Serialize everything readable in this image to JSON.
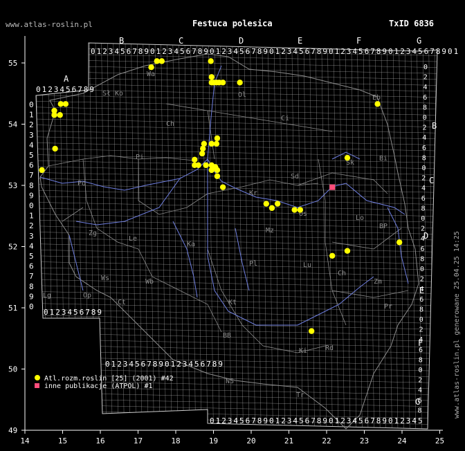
{
  "header": {
    "site": "www.atlas-roslin.pl",
    "title": "Festuca polesica",
    "taxon_id": "TxID 6836"
  },
  "side_note": "www.atlas-roslin.pl generowane 25.04.25 14:25",
  "legend": {
    "items": [
      {
        "label": "Atl.rozm.roslin [25] (2001) #42",
        "color": "#ffff00",
        "marker": "circle"
      },
      {
        "label": "inne publikacje (ATPOL) #1",
        "color": "#ff4d7a",
        "marker": "square"
      }
    ]
  },
  "colors": {
    "background": "#000000",
    "grid": "#b8b8b8",
    "rivers": "#6f7fe0",
    "regions": "#8c8c8c",
    "text": "#ffffff",
    "point_primary": "#ffff00",
    "point_secondary": "#ff4d7a"
  },
  "chart_data": {
    "type": "scatter",
    "x_axis": {
      "ticks": [
        "14",
        "15",
        "16",
        "17",
        "18",
        "19",
        "20",
        "21",
        "22",
        "23",
        "24",
        "25"
      ],
      "range": [
        14,
        25
      ]
    },
    "y_axis": {
      "ticks": [
        "49",
        "50",
        "51",
        "52",
        "53",
        "54",
        "55"
      ],
      "range": [
        49,
        55.4
      ]
    },
    "atpol_columns": [
      "A",
      "B",
      "C",
      "D",
      "E",
      "F",
      "G"
    ],
    "atpol_rows": [
      "A",
      "B",
      "C",
      "D",
      "E",
      "F",
      "G"
    ],
    "digit_string": "0123456789",
    "region_codes": [
      "Ko",
      "Ch",
      "Pi",
      "Po",
      "Zg",
      "Le",
      "Ka",
      "Ws",
      "Wb",
      "Lg",
      "Op",
      "Ct",
      "Kt",
      "BB",
      "NS",
      "Tr",
      "Ki",
      "Rd",
      "Lu",
      "Ch",
      "Zm",
      "Pr",
      "Kr",
      "Sd",
      "Lo",
      "Sk",
      "Mz",
      "Os",
      "Bi",
      "BP",
      "Ci",
      "Ol",
      "Eb",
      "Sł",
      "Wa",
      "Pl"
    ],
    "series": [
      {
        "name": "Atl.rozm.roslin [25] (2001) #42",
        "points": [
          [
            14.45,
            53.25
          ],
          [
            14.8,
            53.6
          ],
          [
            14.78,
            54.15
          ],
          [
            14.78,
            54.22
          ],
          [
            14.93,
            54.15
          ],
          [
            14.95,
            54.33
          ],
          [
            15.08,
            54.33
          ],
          [
            17.35,
            54.93
          ],
          [
            17.5,
            55.03
          ],
          [
            17.63,
            55.03
          ],
          [
            18.93,
            55.03
          ],
          [
            18.95,
            54.77
          ],
          [
            18.95,
            54.68
          ],
          [
            19.0,
            54.68
          ],
          [
            19.08,
            54.68
          ],
          [
            19.15,
            54.68
          ],
          [
            19.25,
            54.68
          ],
          [
            19.7,
            54.68
          ],
          [
            18.5,
            53.42
          ],
          [
            18.6,
            53.33
          ],
          [
            18.5,
            53.33
          ],
          [
            18.7,
            53.52
          ],
          [
            18.72,
            53.6
          ],
          [
            18.75,
            53.68
          ],
          [
            18.95,
            53.68
          ],
          [
            19.08,
            53.68
          ],
          [
            19.1,
            53.77
          ],
          [
            18.8,
            53.33
          ],
          [
            18.95,
            53.33
          ],
          [
            18.95,
            53.25
          ],
          [
            19.05,
            53.3
          ],
          [
            19.1,
            53.25
          ],
          [
            19.1,
            53.15
          ],
          [
            19.25,
            52.97
          ],
          [
            20.4,
            52.7
          ],
          [
            20.55,
            52.63
          ],
          [
            20.7,
            52.7
          ],
          [
            21.15,
            52.6
          ],
          [
            21.3,
            52.6
          ],
          [
            22.55,
            53.45
          ],
          [
            23.35,
            54.33
          ],
          [
            23.93,
            52.07
          ],
          [
            22.55,
            51.93
          ],
          [
            22.15,
            51.85
          ],
          [
            21.6,
            50.62
          ]
        ]
      },
      {
        "name": "inne publikacje (ATPOL) #1",
        "points": [
          [
            22.15,
            52.97
          ]
        ]
      }
    ]
  }
}
